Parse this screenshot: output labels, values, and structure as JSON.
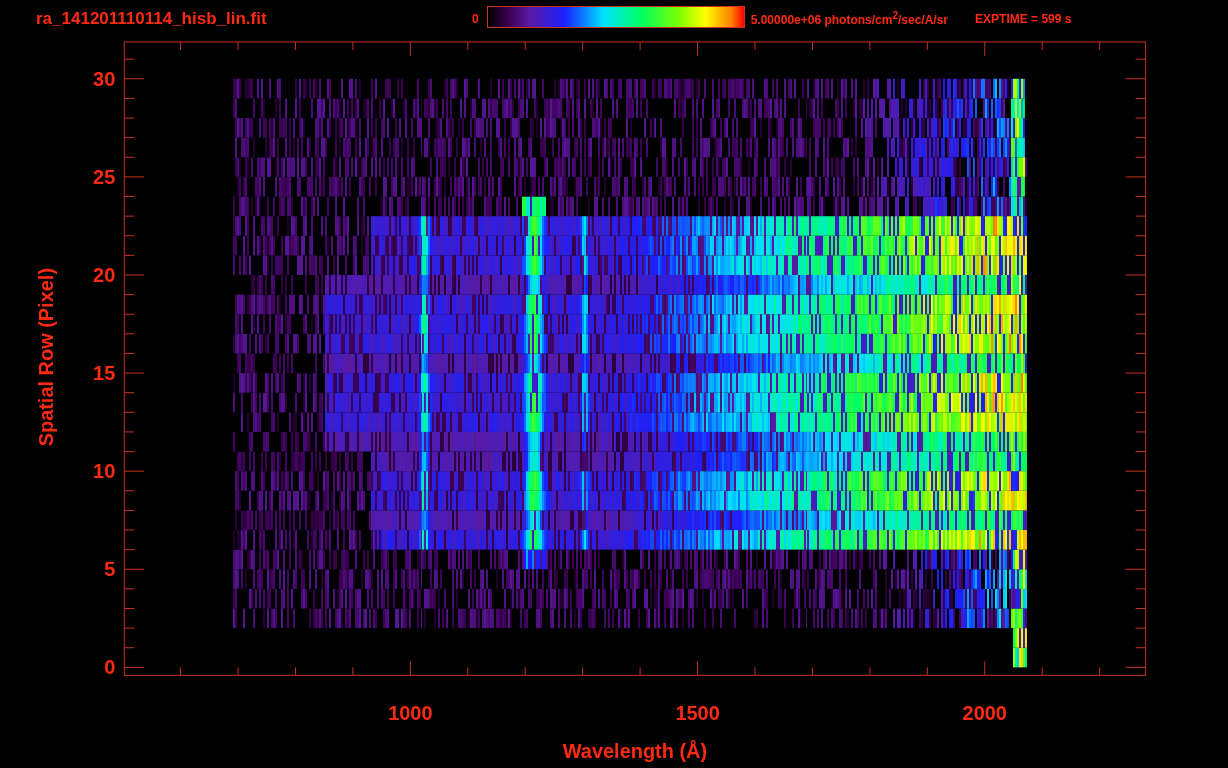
{
  "title": "ra_141201110114_hisb_lin.fit",
  "colorbar": {
    "min_label": "0",
    "max_label": "5.00000e+06 photons/cm$^{2}$/sec/A/sr"
  },
  "exposure": "EXPTIME = 599 s",
  "x_axis": {
    "label": "Wavelength (Å)",
    "ticks": [
      "1000",
      "1500",
      "2000"
    ]
  },
  "y_axis": {
    "label": "Spatial Row (Pixel)",
    "ticks": [
      "30",
      "25",
      "20",
      "15",
      "10",
      "5",
      "0"
    ]
  }
}
